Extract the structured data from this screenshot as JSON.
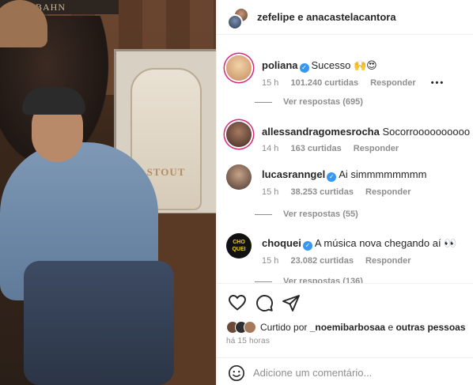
{
  "photo": {
    "sign_text": "EISENBAHN",
    "bottle_label": "STOUT"
  },
  "header": {
    "title": "zefelipe e anacastelacantora"
  },
  "comments": [
    {
      "user": "poliana",
      "verified": true,
      "text": "Sucesso 🙌😍",
      "time": "15 h",
      "likes": "101.240 curtidas",
      "reply": "Responder",
      "more": "•••",
      "view_replies": "Ver respostas (695)",
      "avatar_color": "#d9b48a"
    },
    {
      "user": "allessandragomesrocha",
      "verified": false,
      "text": "Socorroooooooooo 🔥",
      "time": "14 h",
      "likes": "163 curtidas",
      "reply": "Responder",
      "view_replies": "",
      "avatar_color": "#5a3f33"
    },
    {
      "user": "lucasranngel",
      "verified": true,
      "text": "Ai simmmmmmmm",
      "time": "15 h",
      "likes": "38.253 curtidas",
      "reply": "Responder",
      "view_replies": "Ver respostas (55)",
      "avatar_color": "#8a6a55"
    },
    {
      "user": "choquei",
      "verified": true,
      "text": "A música nova chegando aí 👀",
      "time": "15 h",
      "likes": "23.082 curtidas",
      "reply": "Responder",
      "view_replies": "Ver respostas (136)",
      "avatar_color": "#111111",
      "avatar_text": "CHO QUEI"
    }
  ],
  "actions": {
    "like_icon": "heart-icon",
    "comment_icon": "comment-icon",
    "share_icon": "share-icon"
  },
  "liked_by": {
    "prefix": "Curtido por",
    "user": "_noemibarbosaa",
    "middle": "e",
    "others": "outras pessoas"
  },
  "timestamp": "há 15 horas",
  "add_comment": {
    "placeholder": "Adicione um comentário..."
  },
  "colors": {
    "accent_blue": "#3897f0",
    "story_ring": "#d62976",
    "secondary_text": "#8e8e8e"
  }
}
